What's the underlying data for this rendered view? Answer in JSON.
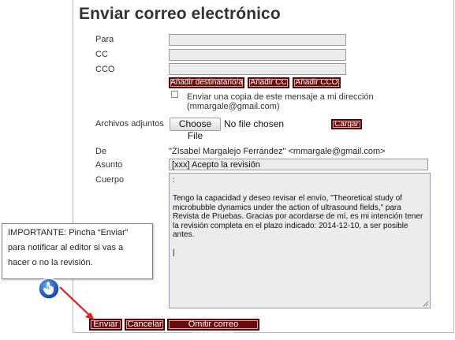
{
  "page": {
    "title": "Enviar correo electrónico"
  },
  "form": {
    "to_label": "Para",
    "cc_label": "CC",
    "bcc_label": "CCO",
    "to_value": "",
    "cc_value": "",
    "bcc_value": "",
    "buttons": {
      "add_recipient": "Añadir destinatario/a",
      "add_cc": "Añadir CC",
      "add_bcc": "Añadir CCO"
    },
    "copy_checkbox": {
      "label": "Enviar una copia de este mensaje a mi dirección (mmargale@gmail.com)",
      "checked": false
    },
    "attachments_label": "Archivos adjuntos",
    "choose_file_label": "Choose File",
    "no_file_text": "No file chosen",
    "upload_label": "Cargar",
    "from_label": "De",
    "from_value": "\"ZIsabel Margalejo Ferrández\" <mmargale@gmail.com>",
    "subject_label": "Asunto",
    "subject_value": "[xxx] Acepto la revisión",
    "body_label": "Cuerpo",
    "body_value": ":\n\nTengo la capacidad y deseo revisar el envío, \"Theoretical study of microbubble dynamics under the action of ultrasound fields,\" para Revista de Pruebas. Gracias por acordarse de mí, es mi intención tener la revisión completa en el plazo indicado: 2014-12-10, a ser posible antes.\n\n|"
  },
  "actions": {
    "send": "Enviar",
    "cancel": "Cancelar",
    "skip": "Omitir correo electrónico"
  },
  "callout": {
    "text": "IMPORTANTE: Pincha “Enviar” para notificar al editor si vas a hacer o no la revisión."
  },
  "icons": {
    "hand": "pointing-hand-icon",
    "arrow": "red-arrow-icon"
  },
  "colors": {
    "button_bg": "#6b0b0b",
    "field_bg": "#ececec",
    "arrow": "#e02020",
    "badge": "#1a5fb4"
  }
}
